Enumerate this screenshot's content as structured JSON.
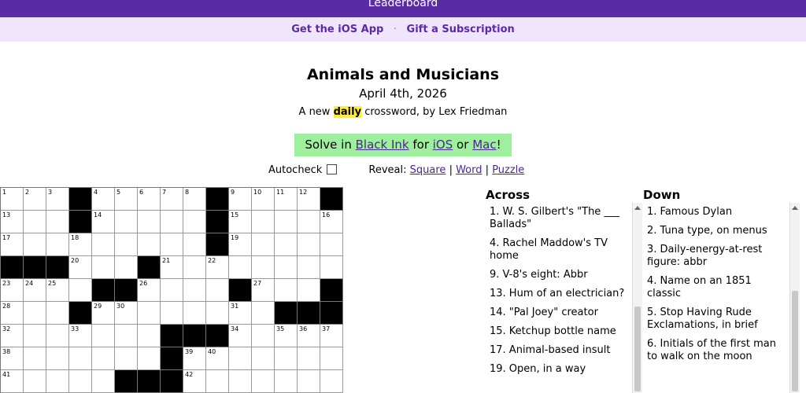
{
  "topbar": {
    "label": "Leaderboard"
  },
  "promo": {
    "ios_app": "Get the iOS App",
    "separator": "·",
    "gift": "Gift a Subscription"
  },
  "puzzle": {
    "title": "Animals and Musicians",
    "date": "April 4th, 2026",
    "byline_prefix": "A new",
    "byline_highlight": "daily",
    "byline_suffix": "crossword, by Lex Friedman"
  },
  "solve": {
    "prefix": "Solve in",
    "app": "Black Ink",
    "for": "for",
    "ios": "iOS",
    "or": "or",
    "mac": "Mac",
    "end": "!"
  },
  "controls": {
    "autocheck": "Autocheck",
    "reveal": "Reveal:",
    "square": "Square",
    "word": "Word",
    "puzzle": "Puzzle",
    "divider": "|"
  },
  "grid": {
    "columns": 15,
    "rows": [
      [
        {
          "n": "1"
        },
        {
          "n": "2"
        },
        {
          "n": "3"
        },
        {
          "b": true
        },
        {
          "n": "4"
        },
        {
          "n": "5"
        },
        {
          "n": "6"
        },
        {
          "n": "7"
        },
        {
          "n": "8"
        },
        {
          "b": true
        },
        {
          "n": "9"
        },
        {
          "n": "10"
        },
        {
          "n": "11"
        },
        {
          "n": "12"
        },
        {
          "b": true
        }
      ],
      [
        {
          "n": "13"
        },
        {},
        {},
        {
          "b": true
        },
        {
          "n": "14"
        },
        {},
        {},
        {},
        {},
        {
          "b": true
        },
        {
          "n": "15"
        },
        {},
        {},
        {},
        {
          "n": "16"
        }
      ],
      [
        {
          "n": "17"
        },
        {},
        {},
        {
          "n": "18"
        },
        {},
        {},
        {},
        {},
        {},
        {
          "b": true
        },
        {
          "n": "19"
        },
        {},
        {},
        {},
        {}
      ],
      [
        {
          "b": true
        },
        {
          "b": true
        },
        {
          "b": true
        },
        {
          "n": "20"
        },
        {},
        {},
        {
          "b": true
        },
        {
          "n": "21"
        },
        {},
        {
          "n": "22"
        },
        {},
        {},
        {},
        {},
        {}
      ],
      [
        {
          "n": "23"
        },
        {
          "n": "24"
        },
        {
          "n": "25"
        },
        {},
        {
          "b": true
        },
        {
          "b": true
        },
        {
          "n": "26"
        },
        {},
        {},
        {},
        {
          "b": true
        },
        {
          "n": "27"
        },
        {},
        {},
        {
          "b": true
        }
      ],
      [
        {
          "n": "28"
        },
        {},
        {},
        {
          "b": true
        },
        {
          "n": "29"
        },
        {
          "n": "30"
        },
        {},
        {},
        {},
        {},
        {
          "n": "31"
        },
        {},
        {
          "b": true
        },
        {
          "b": true
        },
        {
          "b": true
        }
      ],
      [
        {
          "n": "32"
        },
        {},
        {},
        {
          "n": "33"
        },
        {},
        {},
        {},
        {
          "b": true
        },
        {
          "b": true
        },
        {
          "b": true
        },
        {
          "n": "34"
        },
        {},
        {
          "n": "35"
        },
        {
          "n": "36"
        },
        {
          "n": "37"
        }
      ],
      [
        {
          "n": "38"
        },
        {},
        {},
        {},
        {},
        {},
        {},
        {
          "b": true
        },
        {
          "n": "39"
        },
        {
          "n": "40"
        },
        {},
        {},
        {},
        {},
        {}
      ],
      [
        {
          "n": "41"
        },
        {},
        {},
        {},
        {},
        {
          "b": true
        },
        {
          "b": true
        },
        {
          "b": true
        },
        {
          "n": "42"
        },
        {},
        {},
        {},
        {},
        {},
        {}
      ]
    ]
  },
  "across": {
    "heading": "Across",
    "clues": [
      "1. W. S. Gilbert's \"The ___ Ballads\"",
      "4. Rachel Maddow's TV home",
      "9. V-8's eight: Abbr",
      "13. Hum of an electrician?",
      "14. \"Pal Joey\" creator",
      "15. Ketchup bottle name",
      "17. Animal-based insult",
      "19. Open, in a way"
    ]
  },
  "down": {
    "heading": "Down",
    "clues": [
      "1. Famous Dylan",
      "2. Tuna type, on menus",
      "3. Daily-energy-at-rest figure: abbr",
      "4. Name on an 1851 classic",
      "5. Stop Having Rude Exclamations, in brief",
      "6. Initials of the first man to walk on the moon"
    ]
  },
  "colors": {
    "brand": "#5b2aa5",
    "promo_bg": "#efe6fb",
    "solve_bg": "#9ef09e",
    "highlight": "#ffeb3b"
  }
}
